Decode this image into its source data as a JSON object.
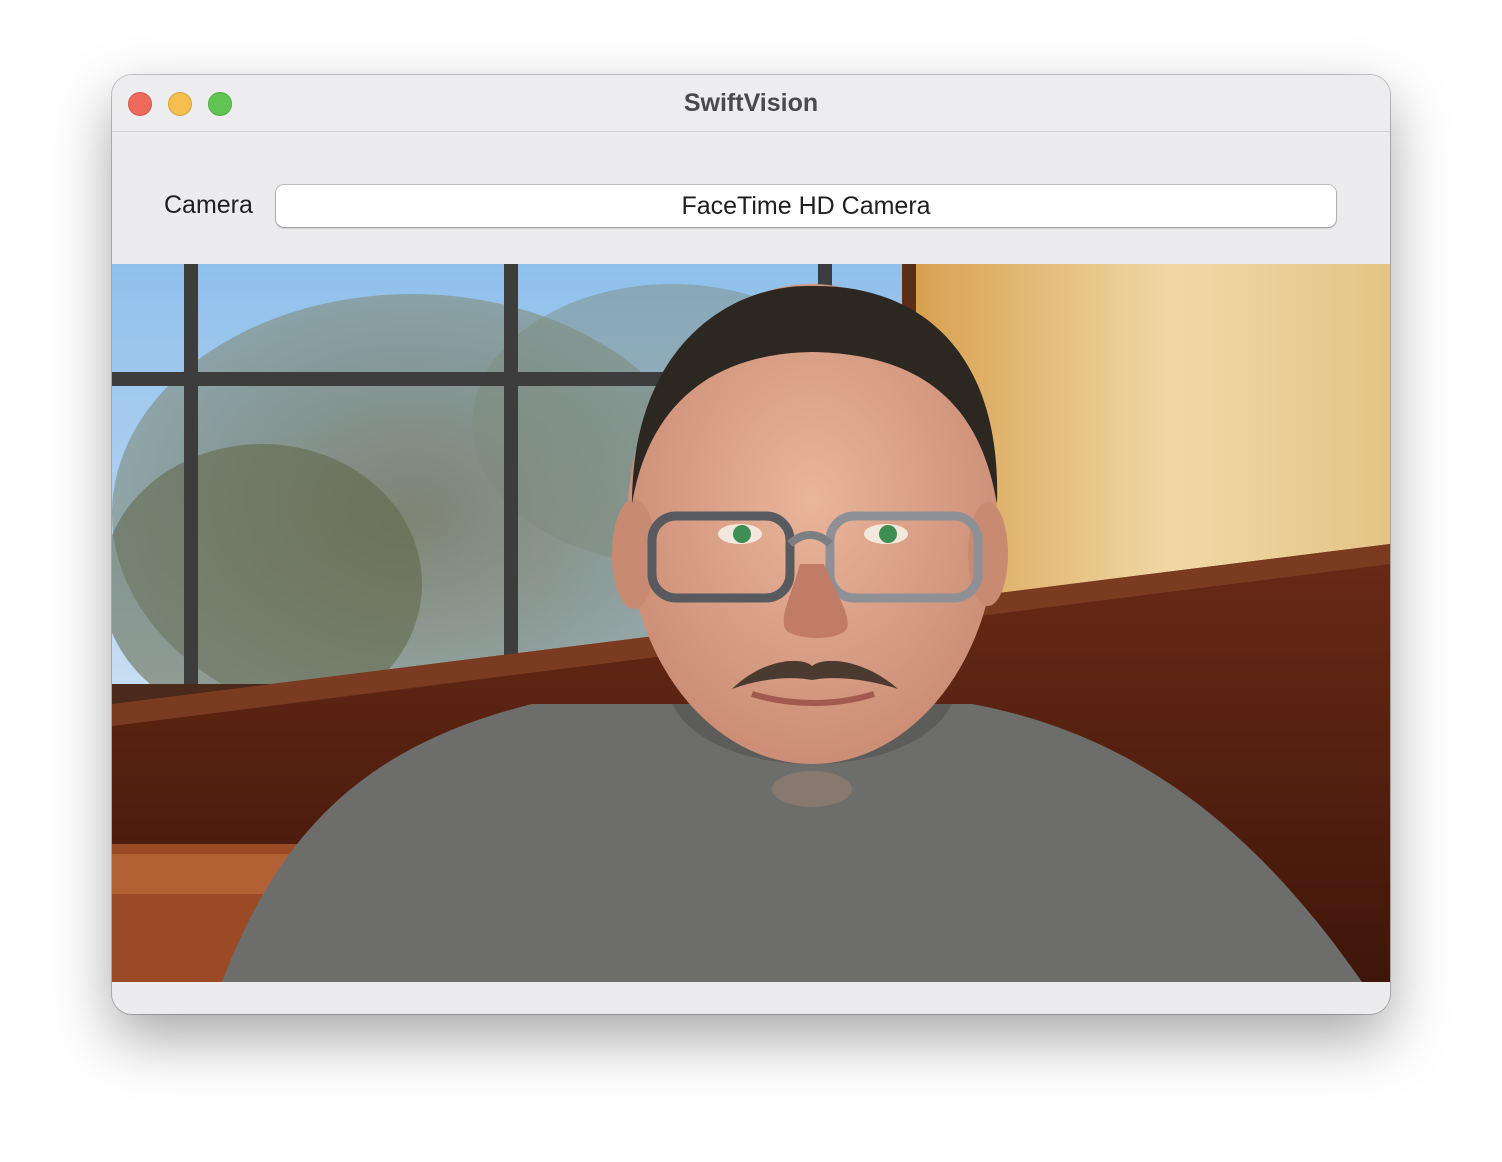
{
  "window": {
    "title": "SwiftVision"
  },
  "controls": {
    "camera_label": "Camera",
    "camera_selected": "FaceTime HD Camera"
  },
  "video_feed": {
    "content": "live-camera-preview"
  },
  "colors": {
    "traffic_close": "#ed6a5e",
    "traffic_minimize": "#f5bf4f",
    "traffic_zoom": "#61c554",
    "window_bg": "#ececee"
  }
}
